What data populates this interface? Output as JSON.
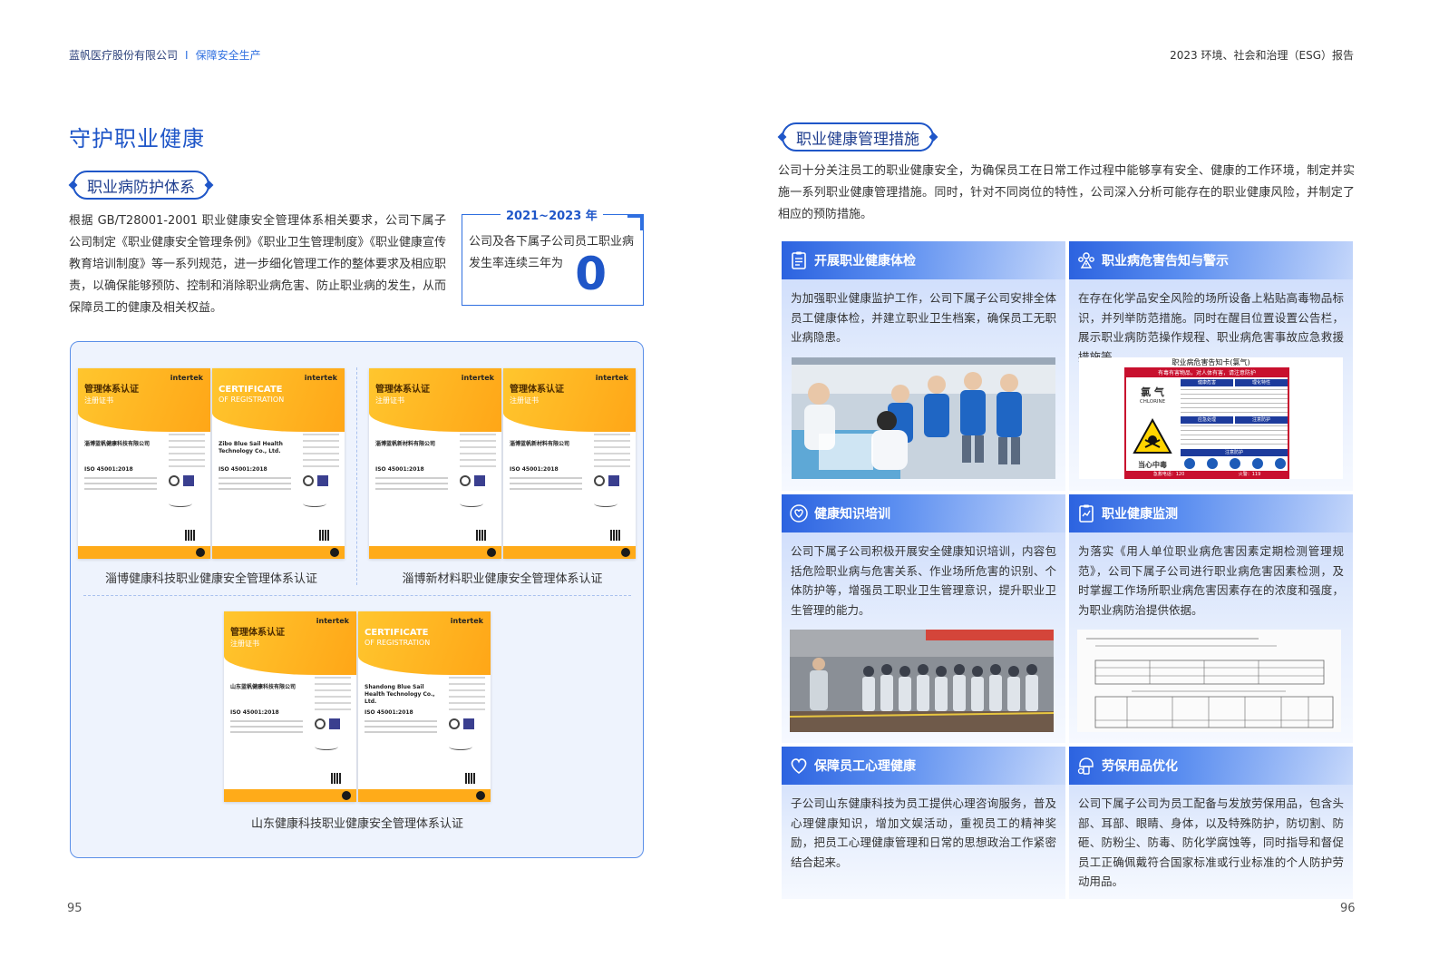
{
  "header": {
    "company": "蓝帆医疗股份有限公司",
    "separator": "I",
    "section": "保障安全生产",
    "report": "2023 环境、社会和治理（ESG）报告"
  },
  "left": {
    "title": "守护职业健康",
    "subsection": "职业病防护体系",
    "paragraph": "根据 GB/T28001-2001 职业健康安全管理体系相关要求，公司下属子公司制定《职业健康安全管理条例》《职业卫生管理制度》《职业健康宣传教育培训制度》等一系列规范，进一步细化管理工作的整体要求及相应职责，以确保能够预防、控制和消除职业病危害、防止职业病的发生，从而保障员工的健康及相关权益。",
    "stat": {
      "years": "2021~2023 年",
      "text": "公司及各下属子公司员工职业病发生率连续三年为",
      "value": "0"
    },
    "certificates": {
      "group1_caption": "淄博健康科技职业健康安全管理体系认证",
      "group2_caption": "淄博新材料职业健康安全管理体系认证",
      "group3_caption": "山东健康科技职业健康安全管理体系认证",
      "brand": "intertek",
      "title_cn": "管理体系认证",
      "subtitle_cn": "注册证书",
      "title_en": "CERTIFICATE",
      "subtitle_en": "OF REGISTRATION",
      "iso": "ISO 45001:2018",
      "company_zb_health_cn": "淄博蓝帆健康科技有限公司",
      "company_zb_health_en": "Zibo Blue Sail Health Technology Co., Ltd.",
      "company_zb_material_cn": "淄博蓝帆新材料有限公司",
      "company_sd_health_cn": "山东蓝帆健康科技有限公司",
      "company_sd_health_en": "Shandong Blue Sail Health Technology Co., Ltd."
    }
  },
  "right": {
    "subsection": "职业健康管理措施",
    "paragraph": "公司十分关注员工的职业健康安全，为确保员工在日常工作过程中能够享有安全、健康的工作环境，制定并实施一系列职业健康管理措施。同时，针对不同岗位的特性，公司深入分析可能存在的职业健康风险，并制定了相应的预防措施。",
    "cards": [
      {
        "title": "开展职业健康体检",
        "icon": "clipboard-icon",
        "body": "为加强职业健康监护工作，公司下属子公司安排全体员工健康体检，并建立职业卫生档案，确保员工无职业病隐患。"
      },
      {
        "title": "职业病危害告知与警示",
        "icon": "warning-people-icon",
        "body": "在存在化学品安全风险的场所设备上粘贴高毒物品标识，并列举防范措施。同时在醒目位置设置公告栏，展示职业病防范操作规程、职业病危害事故应急救援措施等。"
      },
      {
        "title": "健康知识培训",
        "icon": "heart-hands-icon",
        "body": "公司下属子公司积极开展安全健康知识培训，内容包括危险职业病与危害关系、作业场所危害的识别、个体防护等，增强员工职业卫生管理意识，提升职业卫生管理的能力。"
      },
      {
        "title": "职业健康监测",
        "icon": "monitor-report-icon",
        "body": "为落实《用人单位职业病危害因素定期检测管理规范》，公司下属子公司进行职业病危害因素检测，及时掌握工作场所职业病危害因素存在的浓度和强度，为职业病防治提供依据。"
      },
      {
        "title": "保障员工心理健康",
        "icon": "heart-icon",
        "body": "子公司山东健康科技为员工提供心理咨询服务，普及心理健康知识，增加文娱活动，重视员工的精神奖励，把员工心理健康管理和日常的思想政治工作紧密结合起来。"
      },
      {
        "title": "劳保用品优化",
        "icon": "protective-gear-icon",
        "body": "公司下属子公司为员工配备与发放劳保用品，包含头部、耳部、眼睛、身体，以及特殊防护，防切割、防砸、防粉尘、防毒、防化学腐蚀等，同时指导和督促员工正确佩戴符合国家标准或行业标准的个人防护劳动用品。"
      }
    ],
    "warning_card": {
      "title": "职业病危害告知卡(氯气)",
      "banner": "有毒有害物品，对人体有害，请注意防护",
      "substance_cn": "氯  气",
      "substance_en": "CHLORINE",
      "hazard_label": "当心中毒",
      "health_hazard": "健康危害",
      "properties": "理化特性",
      "first_aid": "应急处理",
      "precautions": "注意防护",
      "protection": "注意防护",
      "phone1": "急救电话：120",
      "phone2": "火警：119"
    }
  },
  "page_numbers": {
    "left": "95",
    "right": "96"
  },
  "colors": {
    "primary": "#1f56c8",
    "accent": "#2f6fe0",
    "cert_yellow": "#ffb320",
    "card_head": "#2c63e0"
  }
}
